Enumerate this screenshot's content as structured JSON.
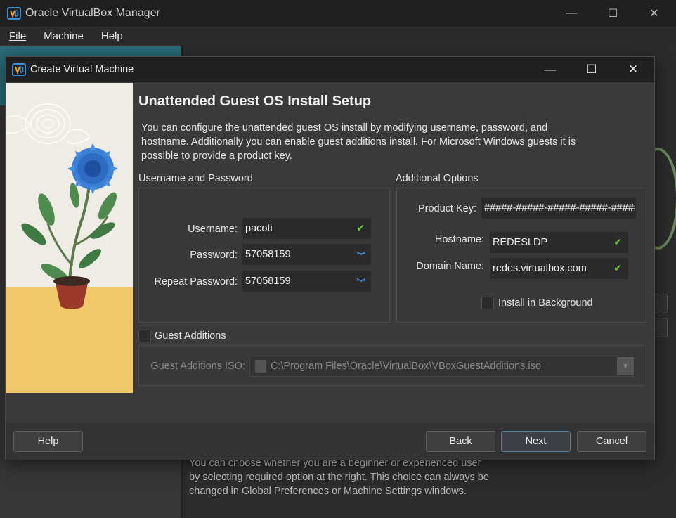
{
  "main_window": {
    "title": "Oracle VirtualBox Manager",
    "menu": [
      "File",
      "Machine",
      "Help"
    ],
    "controls": {
      "minimize": "—",
      "maximize": "☐",
      "close": "✕"
    },
    "background_text": "You can choose whether you are a beginner or experienced user by selecting required option at the right. This choice can always be changed in Global Preferences or Machine Settings windows."
  },
  "dialog": {
    "title": "Create Virtual Machine",
    "controls": {
      "minimize": "—",
      "maximize": "☐",
      "close": "✕"
    },
    "heading": "Unattended Guest OS Install Setup",
    "description": "You can configure the unattended guest OS install by modifying username, password, and hostname. Additionally you can enable guest additions install. For Microsoft Windows guests it is possible to provide a product key.",
    "credentials": {
      "group_label": "Username and Password",
      "username_label": "Username:",
      "username_value": "pacoti",
      "password_label": "Password:",
      "password_value": "57058159",
      "repeat_label": "Repeat Password:",
      "repeat_value": "57058159"
    },
    "options": {
      "group_label": "Additional Options",
      "product_key_label": "Product Key:",
      "product_key_value": "#####-#####-#####-#####-#####",
      "hostname_label": "Hostname:",
      "hostname_value": "REDESLDP",
      "domain_label": "Domain Name:",
      "domain_value": "redes.virtualbox.com",
      "install_bg_label": "Install in Background",
      "install_bg_checked": false
    },
    "guest_additions": {
      "checkbox_label": "Guest Additions",
      "checked": false,
      "iso_label": "Guest Additions ISO:",
      "iso_value": "C:\\Program Files\\Oracle\\VirtualBox\\VBoxGuestAdditions.iso"
    },
    "buttons": {
      "help": "Help",
      "back": "Back",
      "next": "Next",
      "cancel": "Cancel"
    },
    "colors": {
      "valid_check": "#6fcf3a",
      "accent": "#2a6b78"
    }
  }
}
